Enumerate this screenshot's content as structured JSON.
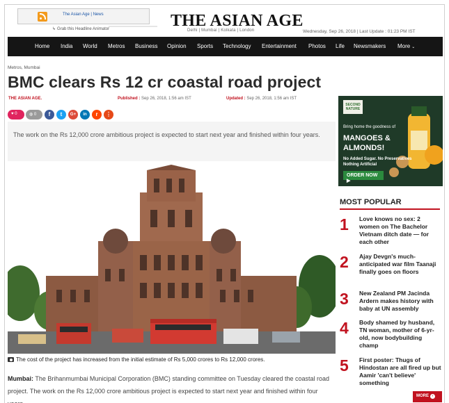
{
  "header": {
    "rss_label": "The Asian Age | News",
    "grab_text": "Grab this Headline Animator",
    "logo": "THE ASIAN AGE",
    "cities": "Delhi | Mumbai | Kolkata | London",
    "date_line": "Wednesday, Sep 26, 2018  |  Last Update : 01:23 PM IST"
  },
  "nav": [
    "Home",
    "India",
    "World",
    "Metros",
    "Business",
    "Opinion",
    "Sports",
    "Technology",
    "Entertainment",
    "Photos",
    "Life",
    "Newsmakers",
    "More"
  ],
  "article": {
    "breadcrumb": "Metros, Mumbai",
    "headline": "BMC clears Rs 12 cr coastal road project",
    "author": "THE ASIAN AGE.",
    "published_label": "Published :",
    "published": "Sep 26, 2018, 1:56 am IST",
    "updated_label": "Updated :",
    "updated": "Sep 26, 2018, 1:56 am IST",
    "likes": "0",
    "comments": "0",
    "summary": "The work on the Rs 12,000 crore ambitious project is expected to start next year and finished within four years.",
    "caption": "The cost of the project has increased from the initial estimate of Rs 5,000 crores to Rs 12,000 crores.",
    "body_lead": "Mumbai:",
    "body": " The Brihanmumbai Municipal Corporation (BMC) standing committee on Tuesday cleared the coastal road project. The work on the Rs 12,000 crore ambitious project is expected to start next year and finished within four years."
  },
  "share_icons": [
    {
      "icon": "facebook-icon",
      "glyph": "f",
      "color": "#3b5998"
    },
    {
      "icon": "twitter-icon",
      "glyph": "t",
      "color": "#1da1f2"
    },
    {
      "icon": "google-plus-icon",
      "glyph": "G+",
      "color": "#dd4b39"
    },
    {
      "icon": "linkedin-icon",
      "glyph": "in",
      "color": "#0077b5"
    },
    {
      "icon": "reddit-icon",
      "glyph": "r",
      "color": "#ff4500"
    },
    {
      "icon": "more-options-icon",
      "glyph": "⋮",
      "color": "#e64a19"
    }
  ],
  "ad": {
    "brand": "SECOND NATURE",
    "line1": "Bring home the goodness of",
    "line2": "MANGOES &",
    "line3": "ALMONDS!",
    "line4": "No Added Sugar. No Preservatives",
    "line5": "Nothing Artificial",
    "cta": "ORDER NOW ▶"
  },
  "most_popular": {
    "title": "MOST POPULAR",
    "items": [
      {
        "num": "1",
        "text": "Love knows no sex: 2 women on The Bachelor Vietnam ditch date — for each other"
      },
      {
        "num": "2",
        "text": "Ajay Devgn's much-anticipated war film Taanaji finally goes on floors"
      },
      {
        "num": "3",
        "text": "New Zealand PM Jacinda Ardern makes history with baby at UN assembly"
      },
      {
        "num": "4",
        "text": "Body shamed by husband, TN woman, mother of 6-yr-old, now bodybuilding champ"
      },
      {
        "num": "5",
        "text": "First poster: Thugs of Hindostan are all fired up but Aamir 'can't believe' something"
      }
    ],
    "more_label": "MORE"
  },
  "colors": {
    "brand_red": "#c1121f",
    "nav_bg": "#151515"
  }
}
